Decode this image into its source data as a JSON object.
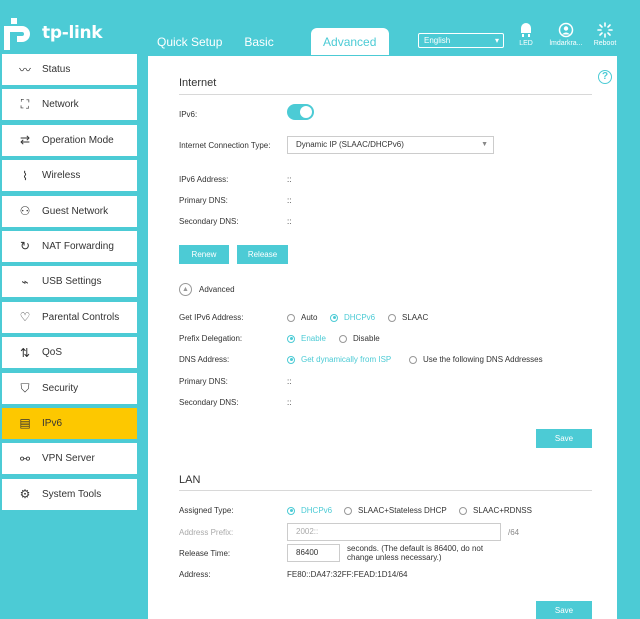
{
  "brand": {
    "name": "tp-link",
    "accent": "#4ccbd5",
    "highlight": "#fdc800"
  },
  "tabs": [
    {
      "label": "Quick Setup",
      "active": false
    },
    {
      "label": "Basic",
      "active": false
    },
    {
      "label": "Advanced",
      "active": true
    }
  ],
  "language": {
    "selected": "English"
  },
  "header_buttons": [
    {
      "label": "LED",
      "icon": "led-icon"
    },
    {
      "label": "lmdarkra...",
      "icon": "user-icon"
    },
    {
      "label": "Reboot",
      "icon": "reboot-icon"
    }
  ],
  "sidebar": {
    "items": [
      {
        "label": "Status",
        "icon": "status-icon"
      },
      {
        "label": "Network",
        "icon": "network-icon"
      },
      {
        "label": "Operation Mode",
        "icon": "operation-mode-icon"
      },
      {
        "label": "Wireless",
        "icon": "wireless-icon"
      },
      {
        "label": "Guest Network",
        "icon": "guest-network-icon"
      },
      {
        "label": "NAT Forwarding",
        "icon": "nat-forwarding-icon"
      },
      {
        "label": "USB Settings",
        "icon": "usb-icon"
      },
      {
        "label": "Parental Controls",
        "icon": "parental-controls-icon"
      },
      {
        "label": "QoS",
        "icon": "qos-icon"
      },
      {
        "label": "Security",
        "icon": "security-icon"
      },
      {
        "label": "IPv6",
        "icon": "ipv6-icon",
        "active": true
      },
      {
        "label": "VPN Server",
        "icon": "vpn-icon"
      },
      {
        "label": "System Tools",
        "icon": "system-tools-icon"
      }
    ]
  },
  "internet": {
    "title": "Internet",
    "ipv6_label": "IPv6:",
    "ipv6_enabled": true,
    "conn_type_label": "Internet Connection Type:",
    "conn_type_value": "Dynamic IP (SLAAC/DHCPv6)",
    "ipv6_address_label": "IPv6 Address:",
    "ipv6_address_value": "::",
    "primary_dns_label": "Primary DNS:",
    "primary_dns_value": "::",
    "secondary_dns_label": "Secondary DNS:",
    "secondary_dns_value": "::",
    "renew_label": "Renew",
    "release_label": "Release",
    "advanced_label": "Advanced",
    "get_ipv6_label": "Get IPv6 Address:",
    "get_ipv6_options": [
      "Auto",
      "DHCPv6",
      "SLAAC"
    ],
    "get_ipv6_selected": "DHCPv6",
    "prefix_label": "Prefix Delegation:",
    "prefix_options": [
      "Enable",
      "Disable"
    ],
    "prefix_selected": "Enable",
    "dns_address_label": "DNS Address:",
    "dns_options": [
      "Get dynamically from ISP",
      "Use the following DNS Addresses"
    ],
    "dns_selected": "Get dynamically from ISP",
    "adv_primary_dns_label": "Primary DNS:",
    "adv_primary_dns_value": "::",
    "adv_secondary_dns_label": "Secondary DNS:",
    "adv_secondary_dns_value": "::",
    "save_label": "Save"
  },
  "lan": {
    "title": "LAN",
    "assigned_type_label": "Assigned Type:",
    "assigned_options": [
      "DHCPv6",
      "SLAAC+Stateless DHCP",
      "SLAAC+RDNSS"
    ],
    "assigned_selected": "DHCPv6",
    "prefix_label": "Address Prefix:",
    "prefix_placeholder": "2002::",
    "prefix_suffix": "/64",
    "release_time_label": "Release Time:",
    "release_time_value": "86400",
    "release_time_note_1": "seconds. (The default is 86400, do not",
    "release_time_note_2": "change unless necessary.)",
    "address_label": "Address:",
    "address_value": "FE80::DA47:32FF:FEAD:1D14/64",
    "save_label": "Save"
  }
}
